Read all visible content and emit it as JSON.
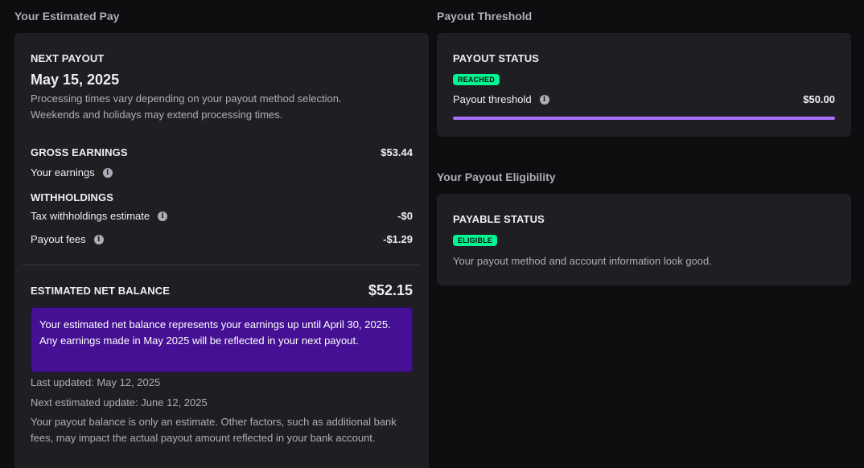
{
  "left": {
    "heading": "Your Estimated Pay",
    "next_payout": {
      "label": "NEXT PAYOUT",
      "date": "May 15, 2025",
      "note_line1": "Processing times vary depending on your payout method selection.",
      "note_line2": "Weekends and holidays may extend processing times."
    },
    "gross": {
      "label": "GROSS EARNINGS",
      "amount": "$53.44",
      "your_earnings_label": "Your earnings"
    },
    "withholdings": {
      "label": "WITHHOLDINGS",
      "tax_label": "Tax withholdings estimate",
      "tax_amount": "-$0",
      "fees_label": "Payout fees",
      "fees_amount": "-$1.29"
    },
    "net": {
      "label": "ESTIMATED NET BALANCE",
      "amount": "$52.15",
      "notice": "Your estimated net balance represents your earnings up until April 30, 2025. Any earnings made in May 2025 will be reflected in your next payout.",
      "last_updated": "Last updated: May 12, 2025",
      "next_update": "Next estimated update: June 12, 2025",
      "disclaimer": "Your payout balance is only an estimate. Other factors, such as additional bank fees, may impact the actual payout amount reflected in your bank account."
    }
  },
  "threshold": {
    "heading": "Payout Threshold",
    "status_label": "PAYOUT STATUS",
    "badge": "REACHED",
    "threshold_label": "Payout threshold",
    "threshold_amount": "$50.00",
    "progress_percent": 100
  },
  "eligibility": {
    "heading": "Your Payout Eligibility",
    "status_label": "PAYABLE STATUS",
    "badge": "ELIGIBLE",
    "message": "Your payout method and account information look good."
  },
  "colors": {
    "background": "#0e0e10",
    "card": "#1f1f23",
    "accent_purple": "#a970ff",
    "notice_purple": "#451093",
    "badge_green": "#00f593"
  },
  "icons": {
    "info": "info-icon"
  }
}
